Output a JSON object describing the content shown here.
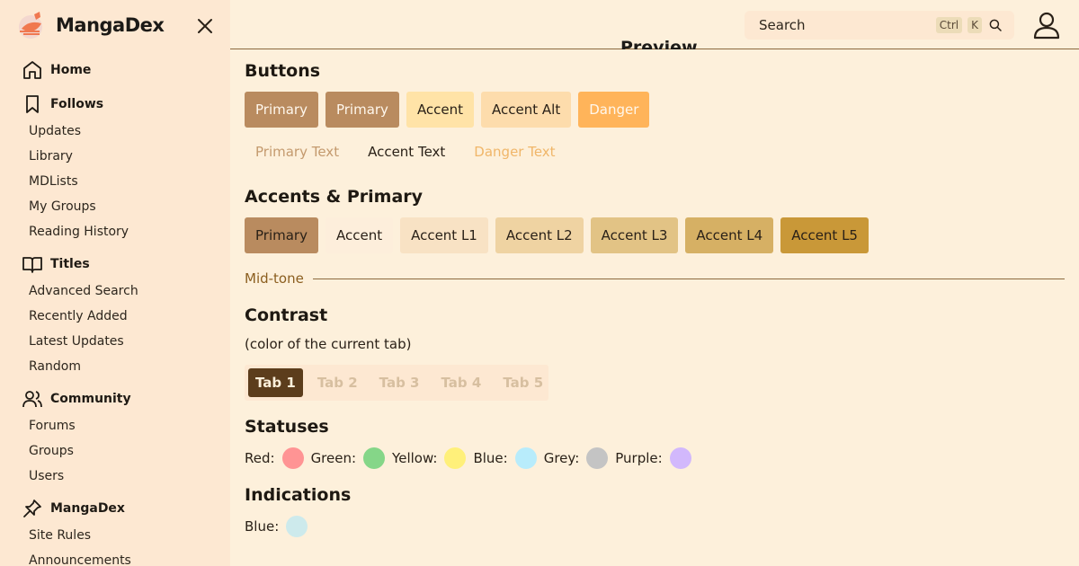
{
  "brand": {
    "name": "MangaDex"
  },
  "sidebar": {
    "sections": [
      {
        "label": "Home",
        "icon": "home-icon",
        "items": []
      },
      {
        "label": "Follows",
        "icon": "bookmark-icon",
        "items": [
          "Updates",
          "Library",
          "MDLists",
          "My Groups",
          "Reading History"
        ]
      },
      {
        "label": "Titles",
        "icon": "book-open-icon",
        "items": [
          "Advanced Search",
          "Recently Added",
          "Latest Updates",
          "Random"
        ]
      },
      {
        "label": "Community",
        "icon": "users-icon",
        "items": [
          "Forums",
          "Groups",
          "Users"
        ]
      },
      {
        "label": "MangaDex",
        "icon": "pin-icon",
        "items": [
          "Site Rules",
          "Announcements"
        ]
      }
    ]
  },
  "header": {
    "search_placeholder": "Search",
    "kbd_ctrl": "Ctrl",
    "kbd_k": "K",
    "page_title": "Preview"
  },
  "main": {
    "buttons_heading": "Buttons",
    "buttons": [
      "Primary",
      "Primary",
      "Accent",
      "Accent Alt",
      "Danger"
    ],
    "text_buttons": [
      "Primary Text",
      "Accent Text",
      "Danger Text"
    ],
    "accents_heading": "Accents & Primary",
    "accents": [
      "Primary",
      "Accent",
      "Accent L1",
      "Accent L2",
      "Accent L3",
      "Accent L4",
      "Accent L5"
    ],
    "midtone_label": "Mid-tone",
    "contrast_heading": "Contrast",
    "contrast_note": "(color of the current tab)",
    "tabs": [
      "Tab 1",
      "Tab 2",
      "Tab 3",
      "Tab 4",
      "Tab 5"
    ],
    "statuses_heading": "Statuses",
    "statuses": [
      {
        "label": "Red:",
        "color": "#ff9494"
      },
      {
        "label": "Green:",
        "color": "#85d688"
      },
      {
        "label": "Yellow:",
        "color": "#fff07a"
      },
      {
        "label": "Blue:",
        "color": "#b8ecfb"
      },
      {
        "label": "Grey:",
        "color": "#c4c4c4"
      },
      {
        "label": "Purple:",
        "color": "#d2b8fc"
      }
    ],
    "indications_heading": "Indications",
    "indications": [
      {
        "label": "Blue:",
        "color": "#cdeaec"
      }
    ]
  },
  "colors": {
    "primary": "#b98b5f",
    "accent": "#ffe3a7",
    "accent_alt": "#fddcac",
    "danger": "#ffb45a",
    "accent_shades": [
      "#b98b5f",
      "#fdeedb",
      "#f8e2c4",
      "#efd3a2",
      "#e2c385",
      "#d6b064",
      "#c99838"
    ],
    "midtone": "#8b6a3e",
    "tab_active": "#5c3d1c",
    "primary_text": "#c49a6e",
    "danger_text": "#f0b669"
  }
}
